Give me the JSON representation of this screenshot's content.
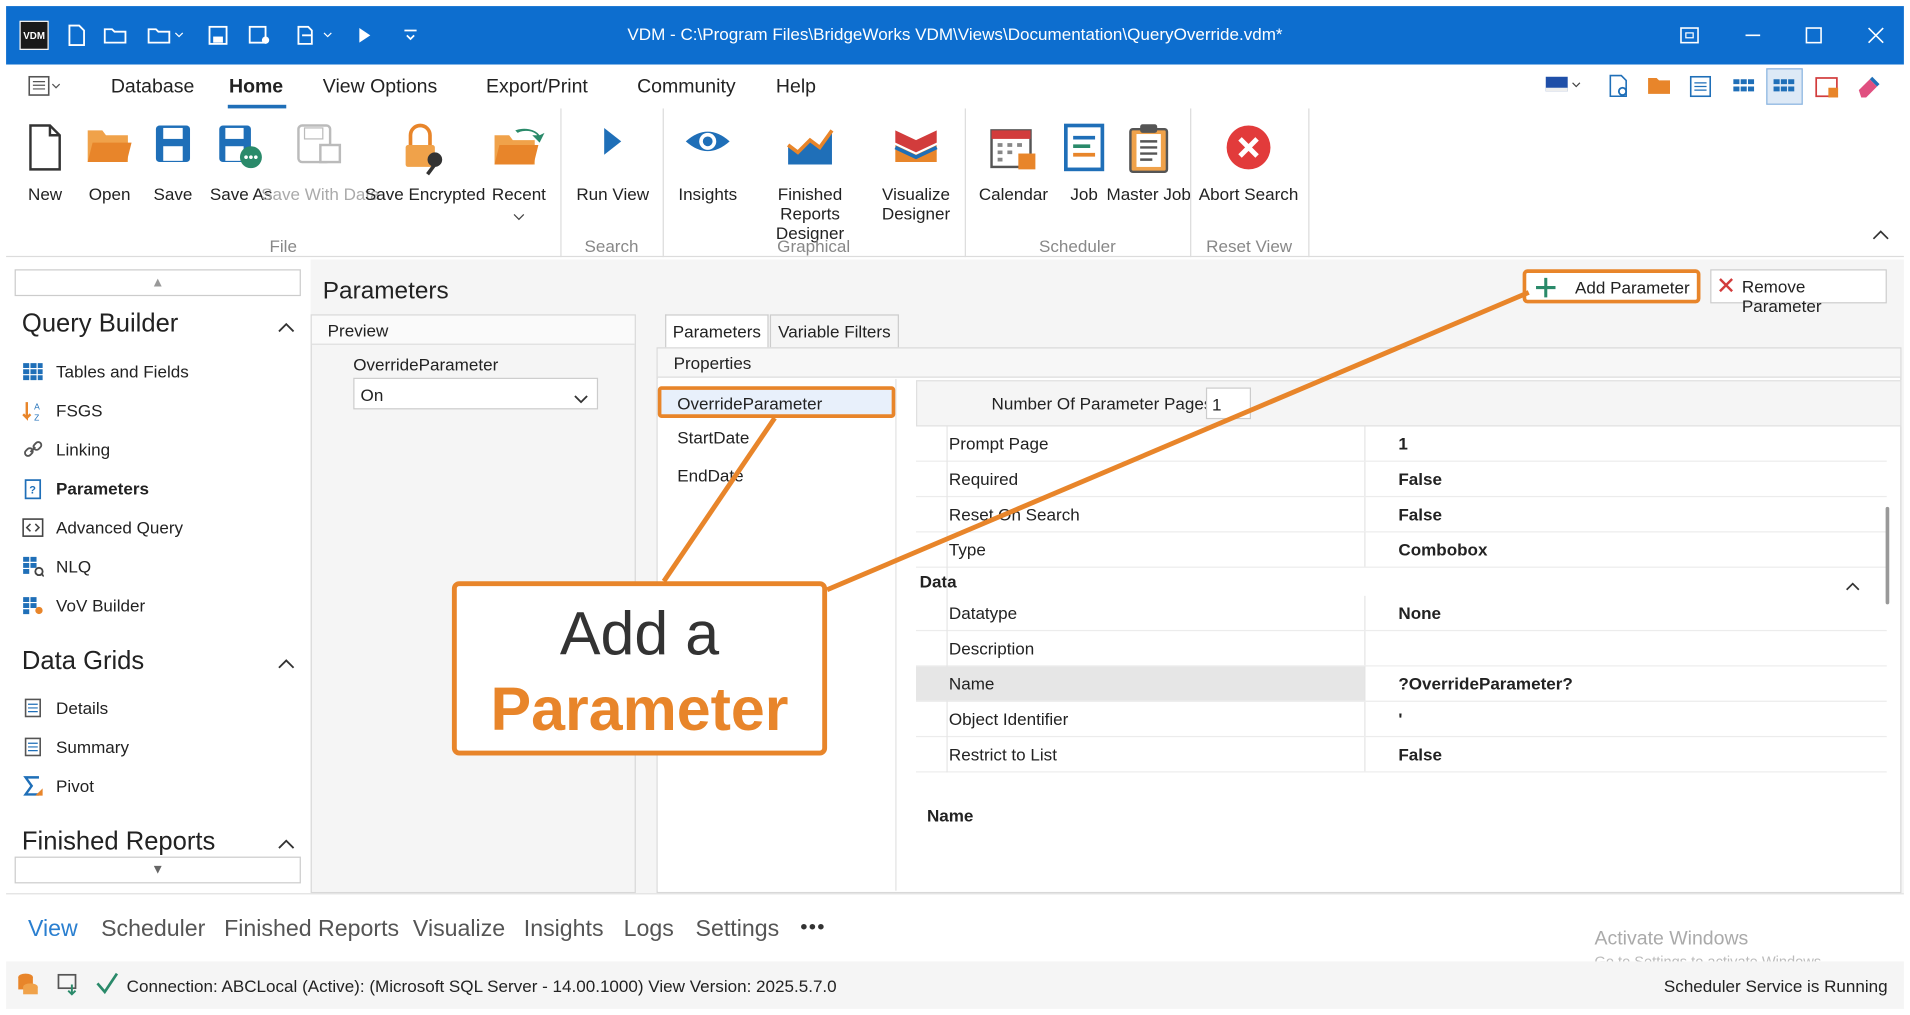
{
  "window": {
    "title": "VDM - C:\\Program Files\\BridgeWorks VDM\\Views\\Documentation\\QueryOverride.vdm*"
  },
  "menu": [
    "Database",
    "Home",
    "View Options",
    "Export/Print",
    "Community",
    "Help"
  ],
  "ribbon": {
    "buttons": [
      "New",
      "Open",
      "Save",
      "Save As",
      "Save With Data",
      "Save Encrypted",
      "Recent",
      "Run View",
      "Insights",
      "Finished Reports Designer",
      "Visualize Designer",
      "Calendar",
      "Job",
      "Master Job",
      "Abort Search"
    ],
    "groups": [
      "File",
      "Search",
      "Graphical",
      "Scheduler",
      "Reset View"
    ]
  },
  "sidebar": {
    "query_builder": {
      "title": "Query Builder",
      "items": [
        "Tables and Fields",
        "FSGS",
        "Linking",
        "Parameters",
        "Advanced Query",
        "NLQ",
        "VoV Builder"
      ]
    },
    "data_grids": {
      "title": "Data Grids",
      "items": [
        "Details",
        "Summary",
        "Pivot"
      ]
    },
    "finished_reports": {
      "title": "Finished Reports"
    }
  },
  "main": {
    "title": "Parameters",
    "add_button": "Add Parameter",
    "remove_button": "Remove Parameter",
    "preview": {
      "header": "Preview",
      "param_label": "OverrideParameter",
      "param_value": "On"
    },
    "tabs": [
      "Parameters",
      "Variable Filters"
    ],
    "properties_header": "Properties",
    "param_list": [
      "OverrideParameter",
      "StartDate",
      "EndDate"
    ],
    "pages_label": "Number Of Parameter Pages",
    "pages_value": "1",
    "rows_top": [
      [
        "Prompt Page",
        "1"
      ],
      [
        "Required",
        "False"
      ],
      [
        "Reset On Search",
        "False"
      ],
      [
        "Type",
        "Combobox"
      ]
    ],
    "data_section": "Data",
    "rows_data": [
      [
        "Datatype",
        "None"
      ],
      [
        "Description",
        ""
      ],
      [
        "Name",
        "?OverrideParameter?"
      ],
      [
        "Object Identifier",
        "'"
      ],
      [
        "Restrict to List",
        "False"
      ]
    ],
    "desc_label": "Name"
  },
  "callout": {
    "line1": "Add a",
    "line2": "Parameter"
  },
  "bottom_nav": [
    "View",
    "Scheduler",
    "Finished Reports",
    "Visualize",
    "Insights",
    "Logs",
    "Settings",
    "•••"
  ],
  "watermark": {
    "line1": "Activate Windows",
    "line2": "Go to Settings to activate Windows."
  },
  "status": {
    "connection": "Connection: ABCLocal (Active): (Microsoft SQL Server - 14.00.1000) View Version: 2025.5.7.0",
    "scheduler": "Scheduler Service is Running"
  },
  "colors": {
    "title_bar": "#0d6ecf",
    "accent_orange": "#e8852a",
    "link_blue": "#1f6fb8"
  }
}
